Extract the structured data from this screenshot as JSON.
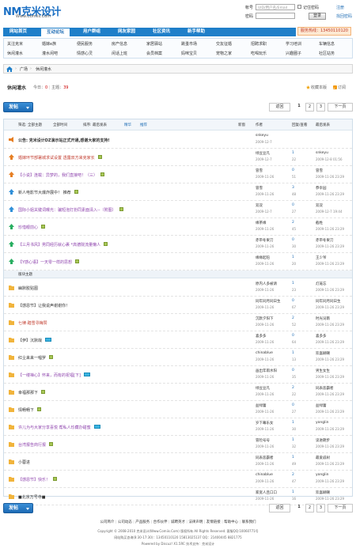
{
  "header": {
    "logo_text": "NM克米设计",
    "logo_sub": "Www.Comiis.Com",
    "login": {
      "account_label": "帐号",
      "account_placeholder": "UID/用户名/Email",
      "password_label": "密码",
      "remember_label": "记住密码",
      "register_label": "注册",
      "login_button": "登录",
      "forgot_label": "找回密码"
    },
    "phone": "服务热线：13450110120"
  },
  "nav": {
    "items": [
      {
        "label": "网站首页",
        "active": false
      },
      {
        "label": "互动论坛",
        "active": true
      },
      {
        "label": "用户群组",
        "active": false
      },
      {
        "label": "网友家园",
        "active": false
      },
      {
        "label": "社区资讯",
        "active": false
      },
      {
        "label": "新手帮助",
        "active": false
      }
    ],
    "sub_row1": [
      "关注克米",
      "婚嫁e族",
      "便民服务",
      "房产信息",
      "家居驿站",
      "跳蚤市场",
      "交友征婚",
      "招聘求职",
      "学习培训",
      "车辆信息"
    ],
    "sub_row2": [
      "休闲灌水",
      "灌水闲吧",
      "情感心灵",
      "闲话上班",
      "会员档案",
      "妈咪宝贝",
      "宠物之家",
      "吃喝玩乐",
      "兴趣圈子",
      "社区站务"
    ]
  },
  "breadcrumb": {
    "items": [
      "广场",
      "休闲灌水"
    ]
  },
  "forum": {
    "name": "休闲灌水",
    "today_label": "今日：",
    "today_value": "0",
    "topics_label": "主题：",
    "topics_value": "39",
    "favorite_label": "收藏本版",
    "subscribe_label": "订阅"
  },
  "post_button": "发帖",
  "pager": {
    "prev": "返回",
    "pages": [
      "1",
      "2",
      "3"
    ],
    "current": "1",
    "next": "下一页"
  },
  "table": {
    "filter_label": "筛选:",
    "filters": [
      "全部主题",
      "全部时间",
      "排序: 最后发表"
    ],
    "filter_links": [
      "精华",
      "推荐"
    ],
    "new_window": "新窗",
    "col_author": "作者",
    "col_replies": "回复/查看",
    "col_last": "最后发表",
    "section_label": "版块主题",
    "sticky": [
      {
        "title": "公告: 克米设计DZ演示站正式开通,感谢大家的支持!",
        "color": "#333",
        "bold": true,
        "icon": "announcement",
        "tag": false,
        "author": "snkeyu",
        "adate": "2009-12-7",
        "replies": "",
        "views": "",
        "last": "",
        "ldate": ""
      },
      {
        "title": "婚嫁环节部署城求试设置 透露双方来克家长",
        "color": "#c0392b",
        "icon": "top3",
        "tag": true,
        "author": "绿豆豆凡",
        "adate": "2009-12-7",
        "replies": "1",
        "views": "22",
        "last": "snkeyu",
        "ldate": "2009-12-8 01:56"
      },
      {
        "title": "【小说】连载：异梦的，我们直接吧！（三）",
        "color": "#8e44ad",
        "icon": "top3",
        "tag": true,
        "author": "冒雪",
        "adate": "2009-11-26",
        "replies": "0",
        "views": "51",
        "last": "冒雪",
        "ldate": "2009-11-26 23:29"
      },
      {
        "title": "新人电影节大爆炸展中！ 推荐",
        "color": "#333",
        "icon": "top2",
        "tag": true,
        "author": "冒雪",
        "adate": "2009-11-26",
        "replies": "3",
        "views": "48",
        "last": "恭幸园",
        "ldate": "2009-11-26 23:29"
      },
      {
        "title": "国际小姐关键词曝光：骗短泡打扮同素面清入--（附图）",
        "color": "#8e44ad",
        "icon": "top2",
        "tag": true,
        "author": "双双",
        "adate": "2009-12-7",
        "replies": "0",
        "views": "27",
        "last": "双双",
        "ldate": "2009-12-7 19:44"
      },
      {
        "title": "珍惜眼前心",
        "color": "#8e44ad",
        "icon": "top1",
        "tag": true,
        "author": "缘茶缘",
        "adate": "2009-11-26",
        "replies": "2",
        "views": "45",
        "last": "截姓",
        "ldate": "2009-11-26 23:29"
      },
      {
        "title": "【三月书风】男同经历就心裹 *高德院流量懒人",
        "color": "#8e44ad",
        "icon": "top1",
        "tag": true,
        "author": "赤带冬果刀",
        "adate": "2009-11-26",
        "replies": "0",
        "views": "30",
        "last": "赤带冬果刀",
        "ldate": "2009-11-26 23:29"
      },
      {
        "title": "【Y感心语】一天零一样的思想",
        "color": "#8e44ad",
        "icon": "top1",
        "tag": true,
        "author": "缘缘起陪",
        "adate": "2009-11-26",
        "replies": "1",
        "views": "20",
        "last": "王少爷",
        "ldate": "2009-11-26 23:29"
      }
    ],
    "normal": [
      {
        "title": "幽默胶贴图",
        "color": "#333",
        "tag": false,
        "author": "原内人多被请",
        "adate": "2009-11-26",
        "replies": "1",
        "views": "23",
        "last": "灯笼忘",
        "ldate": "2009-11-26 23:29"
      },
      {
        "title": "【感恩节】让我说声谢谢你！",
        "color": "#333",
        "tag": false,
        "author": "同年同月同日生",
        "adate": "2009-11-26",
        "replies": "0",
        "views": "67",
        "last": "同年同月同日生",
        "ldate": "2009-11-26 23:29"
      },
      {
        "title": "七律·踏雪寻梅赞",
        "color": "#c0392b",
        "tag": false,
        "author": "沉默夕阳下",
        "adate": "2009-11-26",
        "replies": "2",
        "views": "52",
        "last": "时光词南",
        "ldate": "2009-11-26 23:29"
      },
      {
        "title": "【伊】沉默哉",
        "color": "#333",
        "tag": true,
        "new": true,
        "author": "喜多多",
        "adate": "2009-11-26",
        "replies": "0",
        "views": "64",
        "last": "喜多多",
        "ldate": "2009-11-26 23:29"
      },
      {
        "title": "红尘来来一唱罗",
        "color": "#333",
        "tag": true,
        "author": "chinablue",
        "adate": "2009-11-26",
        "replies": "1",
        "views": "13",
        "last": "欢喜糊嘲",
        "ldate": "2009-11-26 23:29"
      },
      {
        "title": "【一缕禅心】怀来，而有的祝福[下]",
        "color": "#8e44ad",
        "tag": true,
        "new": true,
        "author": "画出年雨水阳",
        "adate": "2009-11-26",
        "replies": "0",
        "views": "35",
        "last": "男生女生",
        "ldate": "2009-11-26 23:29"
      },
      {
        "title": "幸福那那下",
        "color": "#333",
        "tag": true,
        "author": "绿豆豆凡",
        "adate": "2009-11-26",
        "replies": "2",
        "views": "22",
        "last": "同表恶霸者",
        "ldate": "2009-11-26 23:29"
      },
      {
        "title": "情畅畅下",
        "color": "#333",
        "tag": true,
        "author": "益绿蕾",
        "adate": "2009-11-26",
        "replies": "0",
        "views": "27",
        "last": "益绿蕾",
        "ldate": "2009-11-26 23:29"
      },
      {
        "title": "许儿为与大家分享喜悦 帮私人珍藏办甜蜜",
        "color": "#8e44ad",
        "tag": true,
        "new": true,
        "author": "岁下幕乐女",
        "adate": "2009-11-26",
        "replies": "1",
        "views": "30",
        "last": "yonglin",
        "ldate": "2009-11-26 23:29"
      },
      {
        "title": "台湾报告商行报",
        "color": "#8e44ad",
        "tag": true,
        "author": "冒险号号",
        "adate": "2009-11-26",
        "replies": "1",
        "views": "32",
        "last": "读进朗步",
        "ldate": "2009-11-26 23:29"
      },
      {
        "title": "小蓉进",
        "color": "#333",
        "tag": false,
        "author": "同表恶霸者",
        "adate": "2009-11-26",
        "replies": "1",
        "views": "49",
        "last": "最爱戚树",
        "ldate": "2009-11-26 23:29"
      },
      {
        "title": "【感恩节】快乐！",
        "color": "#8e44ad",
        "tag": true,
        "author": "chinablue",
        "adate": "2009-11-26",
        "replies": "2",
        "views": "47",
        "last": "yonglin",
        "ldate": "2009-11-26 23:29"
      },
      {
        "title": "■北京万号寺■",
        "color": "#333",
        "tag": false,
        "author": "家宽人且口口",
        "adate": "2009-11-26",
        "replies": "1",
        "views": "16",
        "last": "欢喜糊嘲",
        "ldate": "2009-11-26 23:29"
      }
    ]
  },
  "footer": {
    "links": [
      "公司简介",
      "公司动态",
      "产品服务",
      "合作伙伴",
      "诚聘英才",
      "法律声明",
      "友情链接",
      "帮助中心",
      "联系我们"
    ],
    "lines": [
      "Copyright © 2008-2010 克米设计(Www.Comiis.Com) 版权所有 All Rights Reserved. 客服QQ:10060771号",
      "网站购买咨询(8:30-17:30)：13450110120 15813025137 QQ：21400445 8821775",
      "Powered by Discuz! X1.5RC   技术支持：克米设计"
    ]
  },
  "colors": {
    "brand_blue": "#1f7fc9",
    "accent_red": "#c0392b",
    "link_purple": "#8e44ad"
  }
}
